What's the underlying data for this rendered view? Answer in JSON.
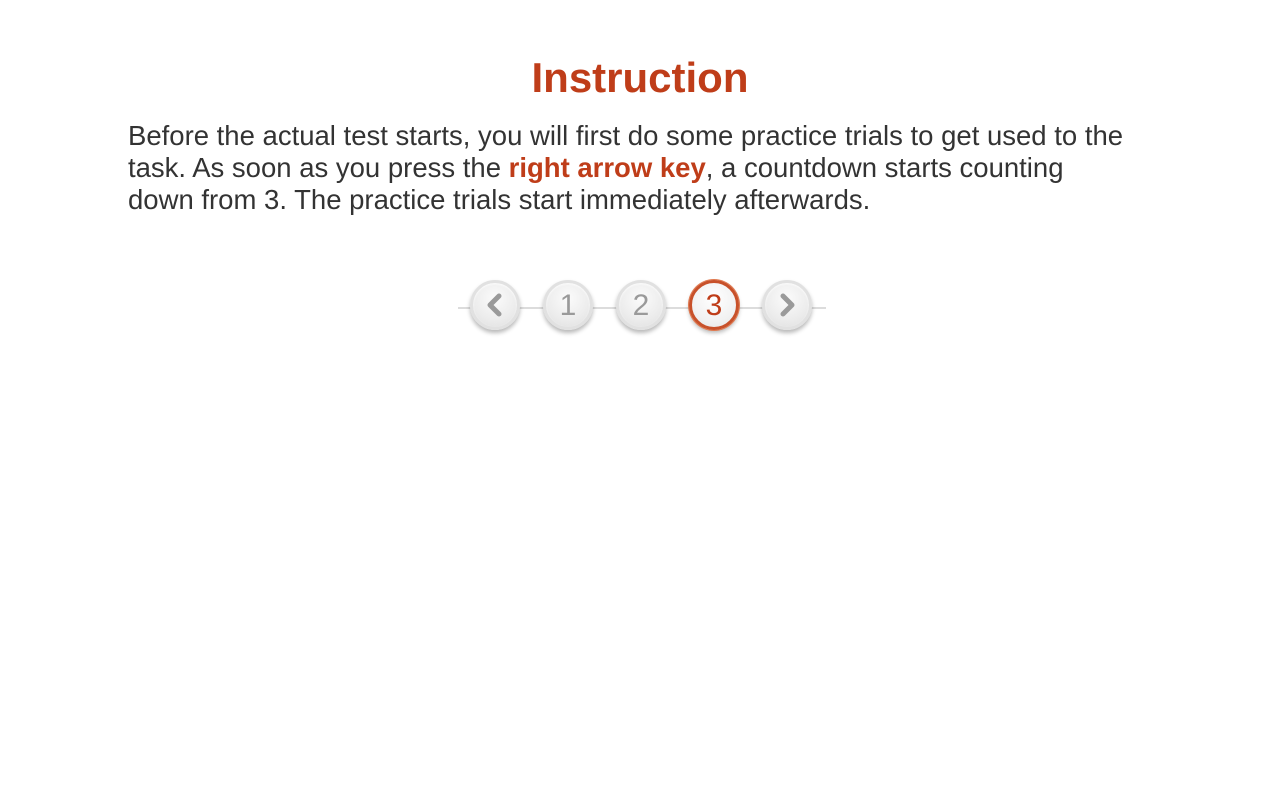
{
  "heading": "Instruction",
  "paragraph": {
    "before": "Before the actual test starts, you will first do some practice trials to get used to the task. As soon as you press the ",
    "highlight": "right arrow key",
    "after": ", a countdown starts counting down from 3. The practice trials start immediately afterwards."
  },
  "pager": {
    "prev_icon": "chevron-left-icon",
    "next_icon": "chevron-right-icon",
    "pages": [
      "1",
      "2",
      "3"
    ],
    "current_page": "3",
    "accent_color": "#bf3d19",
    "inactive_color": "#9a9a9a"
  }
}
